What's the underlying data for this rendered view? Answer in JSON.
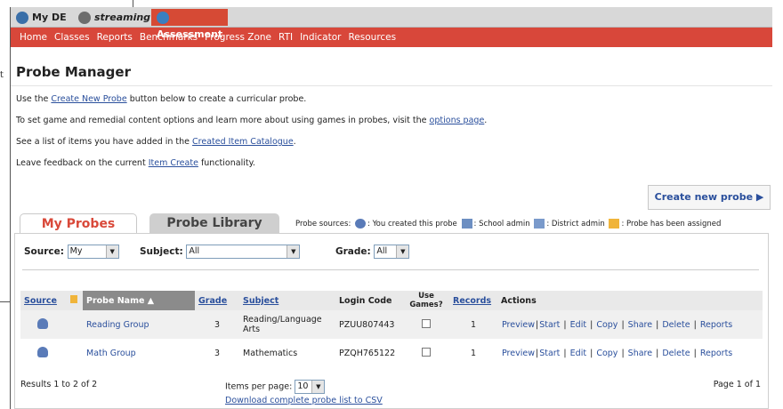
{
  "left_edge": {
    "text": "t"
  },
  "topbar": {
    "tabs": [
      {
        "label": "My DE"
      },
      {
        "label": "streaming"
      },
      {
        "label": "Assessment"
      }
    ]
  },
  "nav": [
    "Home",
    "Classes",
    "Reports",
    "Benchmarks",
    "Progress Zone",
    "RTI",
    "Indicator",
    "Resources"
  ],
  "page_title": "Probe Manager",
  "intro": {
    "line1_pre": "Use the ",
    "line1_link": "Create New Probe",
    "line1_post": " button below to create a curricular probe.",
    "line2_pre": "To set game and remedial content options and learn more about using games in probes, visit the ",
    "line2_link": "options page",
    "line2_post": ".",
    "line3_pre": "See a list of items you have added in the ",
    "line3_link": "Created Item Catalogue",
    "line3_post": ".",
    "line4_pre": "Leave feedback on the current ",
    "line4_link": "Item Create",
    "line4_post": " functionality."
  },
  "create_button": "Create new probe ▶",
  "probe_tabs": {
    "my": "My Probes",
    "library": "Probe Library"
  },
  "legend": {
    "label": "Probe sources:",
    "you": ": You created this probe",
    "school": ": School admin",
    "district": ": District admin",
    "assigned": ": Probe has been assigned"
  },
  "filters": {
    "source_label": "Source:",
    "source_value": "My",
    "subject_label": "Subject:",
    "subject_value": "All",
    "grade_label": "Grade:",
    "grade_value": "All"
  },
  "table": {
    "headers": [
      "Source",
      "",
      "Probe Name ▲",
      "Grade",
      "Subject",
      "Login Code",
      "Use Games?",
      "Records",
      "Actions"
    ],
    "rows": [
      {
        "name": "Reading Group",
        "grade": "3",
        "subject": "Reading/Language Arts",
        "login": "PZUU807443",
        "records": "1"
      },
      {
        "name": "Math Group",
        "grade": "3",
        "subject": "Mathematics",
        "login": "PZQH765122",
        "records": "1"
      }
    ],
    "actions": [
      "Preview",
      "Start",
      "Edit",
      "Copy",
      "Share",
      "Delete",
      "Reports"
    ]
  },
  "footer": {
    "results": "Results 1 to 2 of 2",
    "ipp_label": "Items per page:",
    "ipp_value": "10",
    "download": "Download complete probe list to CSV",
    "page": "Page 1 of 1"
  }
}
